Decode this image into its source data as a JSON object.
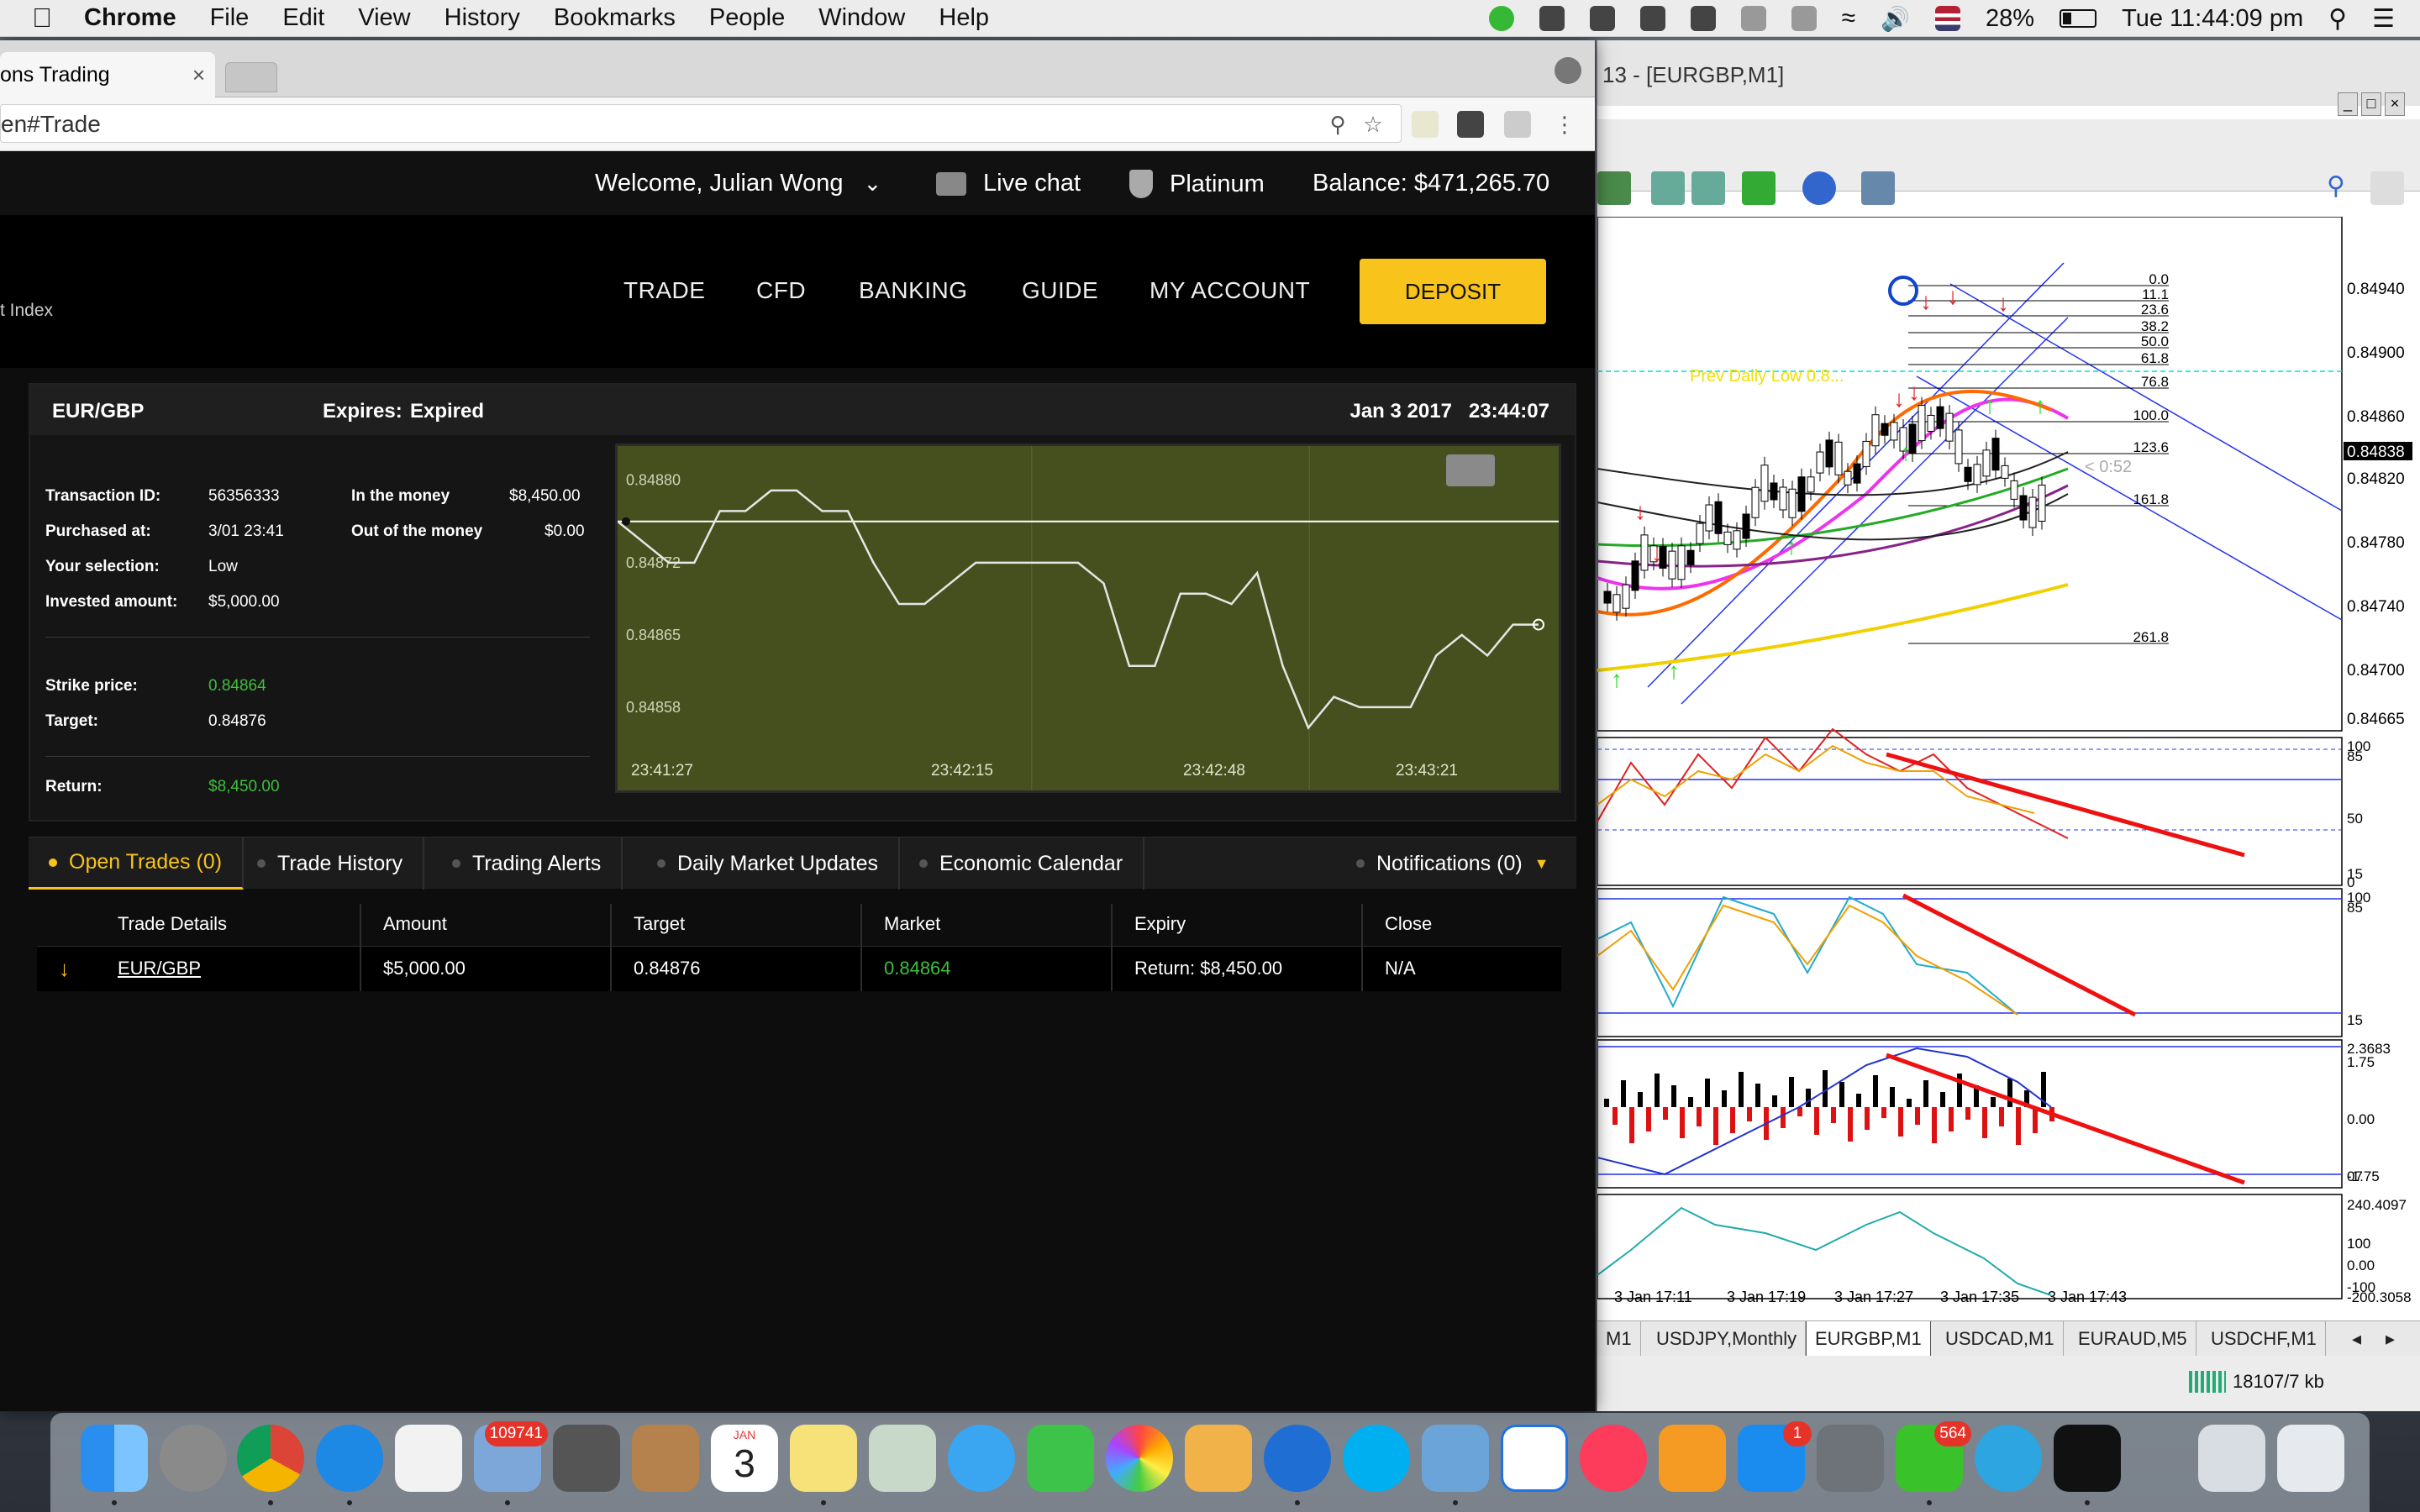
{
  "menubar": {
    "app": "Chrome",
    "items": [
      "File",
      "Edit",
      "View",
      "History",
      "Bookmarks",
      "People",
      "Window",
      "Help"
    ],
    "battery": "28%",
    "clock": "Tue 11:44:09 pm"
  },
  "browser": {
    "tab_title": "ons Trading",
    "tab_close": "×",
    "url": "en#Trade"
  },
  "site": {
    "welcome": "Welcome, Julian Wong",
    "live_chat": "Live chat",
    "tier": "Platinum",
    "balance": "Balance: $471,265.70",
    "logo_fragment": "t Index",
    "nav": [
      "TRADE",
      "CFD",
      "BANKING",
      "GUIDE",
      "MY ACCOUNT"
    ],
    "deposit": "DEPOSIT"
  },
  "trade": {
    "pair": "EUR/GBP",
    "expires_label": "Expires:",
    "expires_value": "Expired",
    "datetime": "Jan 3 2017   23:44:07",
    "transaction_id_label": "Transaction ID:",
    "transaction_id": "56356333",
    "purchased_label": "Purchased at:",
    "purchased": "3/01 23:41",
    "selection_label": "Your selection:",
    "selection": "Low",
    "invested_label": "Invested amount:",
    "invested": "$5,000.00",
    "in_money_label": "In the money",
    "in_money": "$8,450.00",
    "out_money_label": "Out of the money",
    "out_money": "$0.00",
    "strike_label": "Strike price:",
    "strike": "0.84864",
    "target_label": "Target:",
    "target": "0.84876",
    "return_label": "Return:",
    "return": "$8,450.00"
  },
  "chart_data": {
    "type": "line",
    "y_ticks": [
      "0.84880",
      "0.84872",
      "0.84865",
      "0.84858"
    ],
    "x_ticks": [
      "23:41:27",
      "23:42:15",
      "23:42:48",
      "23:43:21"
    ],
    "ylim": [
      0.84854,
      0.84882
    ],
    "target_line": 0.84876,
    "values": [
      0.84876,
      0.84874,
      0.84872,
      0.84872,
      0.84877,
      0.84877,
      0.84879,
      0.84879,
      0.84877,
      0.84877,
      0.84872,
      0.84868,
      0.84868,
      0.8487,
      0.84872,
      0.84872,
      0.84872,
      0.84872,
      0.84872,
      0.8487,
      0.84862,
      0.84862,
      0.84869,
      0.84869,
      0.84868,
      0.84871,
      0.84862,
      0.84856,
      0.84859,
      0.84858,
      0.84858,
      0.84858,
      0.84863,
      0.84865,
      0.84863,
      0.84866,
      0.84866
    ],
    "colors": {
      "bg": "#46501e",
      "line": "#e6e6e6",
      "target": "#ffffff"
    }
  },
  "bottom_tabs": {
    "open_trades": "Open Trades (0)",
    "trade_history": "Trade History",
    "trading_alerts": "Trading Alerts",
    "daily_updates": "Daily Market Updates",
    "economic_calendar": "Economic Calendar",
    "notifications": "Notifications (0)"
  },
  "table": {
    "headers": [
      "Trade Details",
      "Amount",
      "Target",
      "Market",
      "Expiry",
      "Close"
    ],
    "row": {
      "arrow": "↓",
      "pair": "EUR/GBP",
      "amount": "$5,000.00",
      "target": "0.84876",
      "market": "0.84864",
      "expiry": "Return: $8,450.00",
      "close": "N/A"
    }
  },
  "mt4": {
    "title": "13 - [EURGBP,M1]",
    "price_axis": [
      "0.84940",
      "0.84900",
      "0.84860",
      "0.84838",
      "0.84820",
      "0.84780",
      "0.84740",
      "0.84700",
      "0.84665"
    ],
    "fib_levels": [
      "0.0",
      "11.1",
      "23.6",
      "38.2",
      "50.0",
      "61.8",
      "76.8",
      "100.0",
      "123.6",
      "161.8",
      "261.8"
    ],
    "prev_daily": "Prev Daily Low 0.8...",
    "small_label": "< 0:52",
    "ind1_levels": [
      "100",
      "85",
      "50",
      "15",
      "0"
    ],
    "ind2_levels": [
      "100",
      "85",
      "15"
    ],
    "ind3_levels": [
      "2.3683",
      "1.75",
      "0.00",
      "-1.75",
      "07"
    ],
    "ind4_levels": [
      "240.4097",
      "100",
      "0.00",
      "-100",
      "-200.3058"
    ],
    "time_axis": [
      "3 Jan 17:11",
      "3 Jan 17:19",
      "3 Jan 17:27",
      "3 Jan 17:35",
      "3 Jan 17:43"
    ],
    "tabs": [
      "M1",
      "USDJPY,Monthly",
      "EURGBP,M1",
      "USDCAD,M1",
      "EURAUD,M5",
      "USDCHF,M1"
    ],
    "status": "18107/7 kb"
  },
  "dock": {
    "badges": {
      "mail": "109741",
      "appstore": "1",
      "line": "564"
    },
    "calendar_month": "JAN",
    "calendar_day": "3"
  }
}
